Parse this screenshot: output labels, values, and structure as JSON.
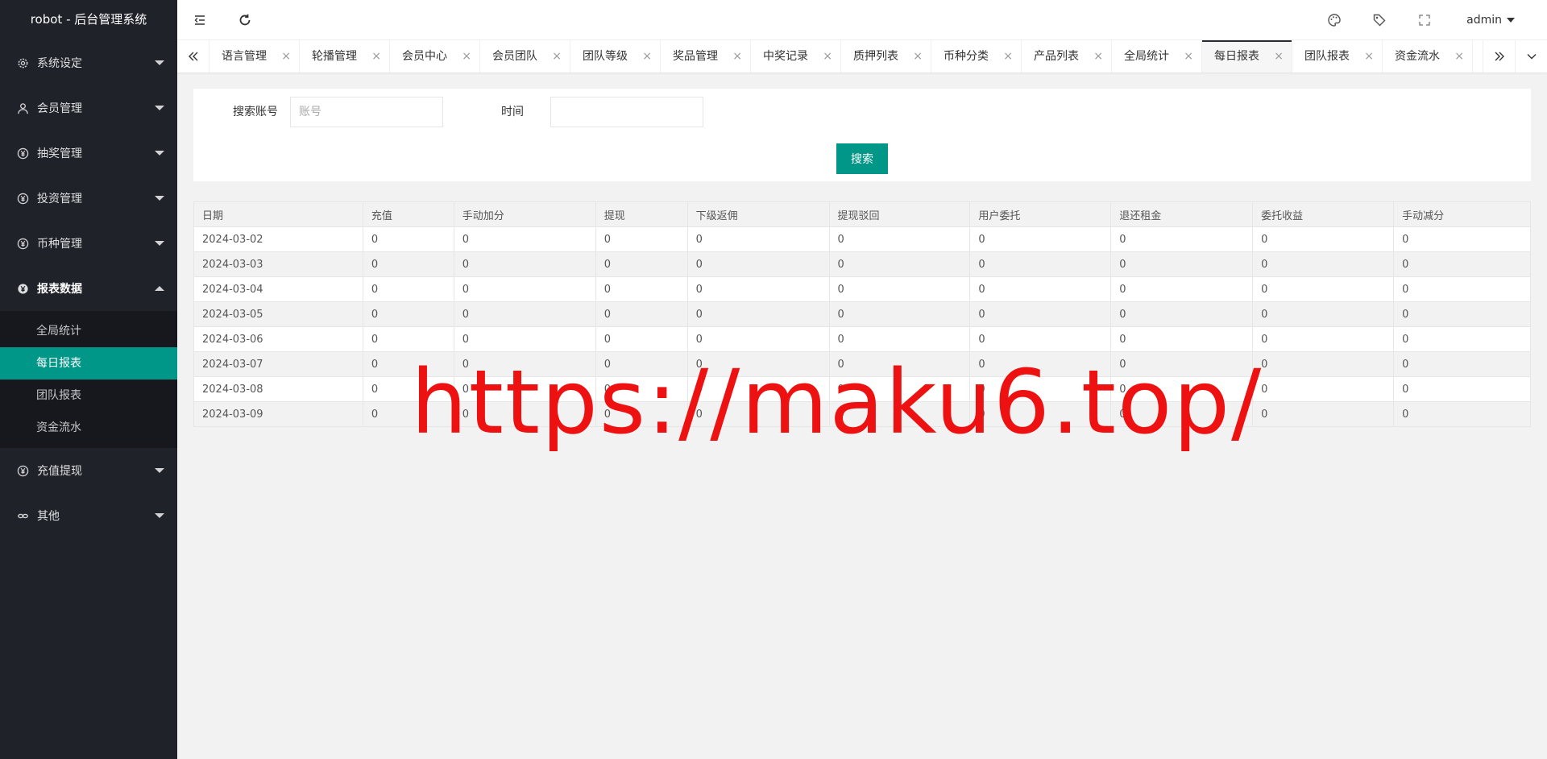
{
  "app": {
    "title": "robot - 后台管理系统"
  },
  "sidebar": {
    "items": [
      {
        "label": "系统设定",
        "icon": "gear-icon"
      },
      {
        "label": "会员管理",
        "icon": "user-icon"
      },
      {
        "label": "抽奖管理",
        "icon": "yen-circle-icon"
      },
      {
        "label": "投资管理",
        "icon": "yen-circle-icon"
      },
      {
        "label": "币种管理",
        "icon": "yen-circle-icon"
      },
      {
        "label": "报表数据",
        "icon": "yen-circle-icon",
        "expanded": true
      },
      {
        "label": "充值提现",
        "icon": "yen-circle-icon"
      },
      {
        "label": "其他",
        "icon": "link-icon"
      }
    ],
    "report_subitems": [
      {
        "label": "全局统计"
      },
      {
        "label": "每日报表",
        "active": true
      },
      {
        "label": "团队报表"
      },
      {
        "label": "资金流水"
      }
    ]
  },
  "header": {
    "user": "admin",
    "icons": [
      "menu-fold-icon",
      "refresh-icon",
      "theme-icon",
      "tag-icon",
      "fullscreen-icon"
    ]
  },
  "tabs": [
    {
      "label": "语言管理"
    },
    {
      "label": "轮播管理"
    },
    {
      "label": "会员中心"
    },
    {
      "label": "会员团队"
    },
    {
      "label": "团队等级"
    },
    {
      "label": "奖品管理"
    },
    {
      "label": "中奖记录"
    },
    {
      "label": "质押列表"
    },
    {
      "label": "币种分类"
    },
    {
      "label": "产品列表"
    },
    {
      "label": "全局统计"
    },
    {
      "label": "每日报表",
      "active": true
    },
    {
      "label": "团队报表"
    },
    {
      "label": "资金流水"
    }
  ],
  "tab_close": "×",
  "search": {
    "account_label": "搜索账号",
    "account_placeholder": "账号",
    "time_label": "时间",
    "time_value": "",
    "button_label": "搜索"
  },
  "table": {
    "columns": [
      "日期",
      "充值",
      "手动加分",
      "提现",
      "下级返佣",
      "提现驳回",
      "用户委托",
      "退还租金",
      "委托收益",
      "手动减分"
    ],
    "rows": [
      [
        "2024-03-02",
        "0",
        "0",
        "0",
        "0",
        "0",
        "0",
        "0",
        "0",
        "0"
      ],
      [
        "2024-03-03",
        "0",
        "0",
        "0",
        "0",
        "0",
        "0",
        "0",
        "0",
        "0"
      ],
      [
        "2024-03-04",
        "0",
        "0",
        "0",
        "0",
        "0",
        "0",
        "0",
        "0",
        "0"
      ],
      [
        "2024-03-05",
        "0",
        "0",
        "0",
        "0",
        "0",
        "0",
        "0",
        "0",
        "0"
      ],
      [
        "2024-03-06",
        "0",
        "0",
        "0",
        "0",
        "0",
        "0",
        "0",
        "0",
        "0"
      ],
      [
        "2024-03-07",
        "0",
        "0",
        "0",
        "0",
        "0",
        "0",
        "0",
        "0",
        "0"
      ],
      [
        "2024-03-08",
        "0",
        "0",
        "0",
        "0",
        "0",
        "0",
        "0",
        "0",
        "0"
      ],
      [
        "2024-03-09",
        "0",
        "0",
        "0",
        "0",
        "0",
        "0",
        "0",
        "0",
        "0"
      ]
    ]
  },
  "watermark": "https://maku6.top/",
  "colors": {
    "sidebar_bg": "#20222a",
    "accent": "#009688",
    "watermark": "#ee1111"
  }
}
